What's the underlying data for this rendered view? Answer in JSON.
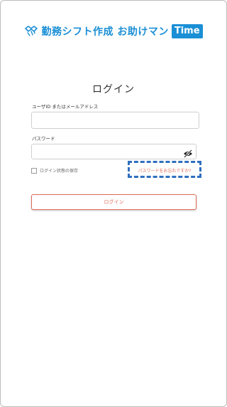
{
  "brand": {
    "text": "勤務シフト作成 お助けマン",
    "badge": "Time",
    "accent_color": "#1a8fd6",
    "icon": "handshake-icon"
  },
  "login": {
    "title": "ログイン",
    "user_label": "ユーザID またはメールアドレス",
    "user_value": "",
    "password_label": "パスワード",
    "password_value": "",
    "password_toggle_icon": "eye-off-icon",
    "remember_label": "ログイン状態の保存",
    "forgot_link": "パスワードをお忘れですか?",
    "submit_label": "ログイン",
    "action_color": "#e06c5a"
  }
}
